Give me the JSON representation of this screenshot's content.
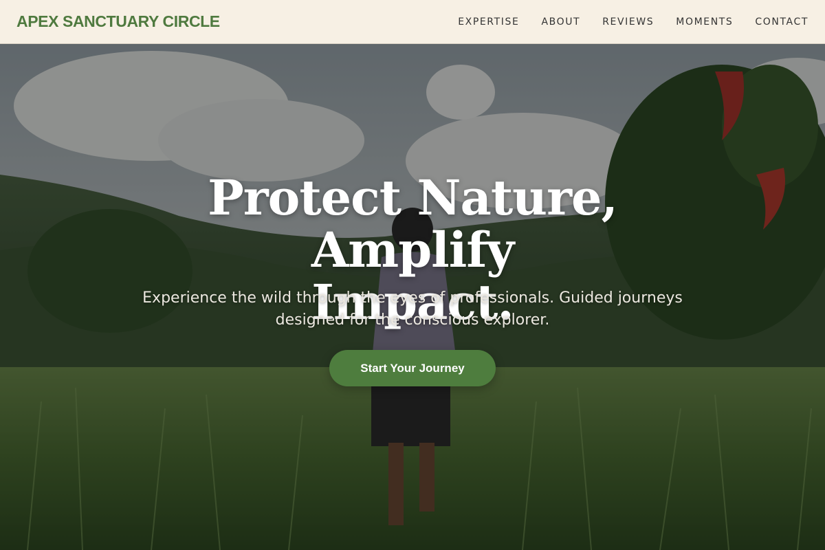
{
  "header": {
    "brand": "APEX SANCTUARY CIRCLE",
    "nav": [
      {
        "label": "EXPERTISE"
      },
      {
        "label": "ABOUT"
      },
      {
        "label": "REVIEWS"
      },
      {
        "label": "MOMENTS"
      },
      {
        "label": "CONTACT"
      }
    ]
  },
  "hero": {
    "title_line1": "Protect Nature, Amplify",
    "title_line2": "Impact.",
    "subtitle": "Experience the wild through the eyes of professionals. Guided journeys designed for the conscious explorer.",
    "cta_label": "Start Your Journey"
  },
  "colors": {
    "header_bg": "#f7f0e4",
    "brand_green": "#4f7a3f",
    "cta_green": "#4e7d3e"
  }
}
